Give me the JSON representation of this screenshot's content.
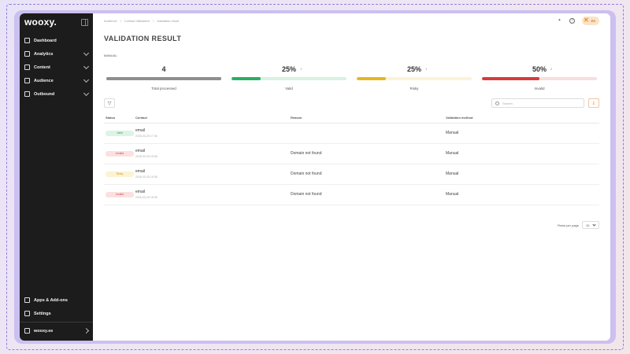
{
  "app": {
    "logo": "wooxy."
  },
  "sidebar": {
    "items": [
      {
        "label": "Dashboard",
        "has_children": false
      },
      {
        "label": "Analytics",
        "has_children": true
      },
      {
        "label": "Content",
        "has_children": true
      },
      {
        "label": "Audience",
        "has_children": true
      },
      {
        "label": "Outbound",
        "has_children": true
      }
    ],
    "bottom": [
      {
        "label": "Apps & Add-ons"
      },
      {
        "label": "Settings"
      }
    ],
    "workspace": "wooxy.ee"
  },
  "breadcrumb": [
    "Audience",
    "Contact Validation",
    "Validation result"
  ],
  "header": {
    "avatar_initials": "ES"
  },
  "page": {
    "title": "VALIDATION RESULT",
    "section": "MANUAL"
  },
  "stats": [
    {
      "value": "4",
      "sub": "",
      "label": "Total processed",
      "fill": 1.0,
      "color": "#8e8e8e",
      "track": "#8e8e8e"
    },
    {
      "value": "25%",
      "sub": "1",
      "label": "Valid",
      "fill": 0.25,
      "color": "#2aaf63",
      "track": "#d7f2e3"
    },
    {
      "value": "25%",
      "sub": "1",
      "label": "Risky",
      "fill": 0.25,
      "color": "#e6b820",
      "track": "#faf3d6"
    },
    {
      "value": "50%",
      "sub": "2",
      "label": "Invalid",
      "fill": 0.5,
      "color": "#d83a3a",
      "track": "#f9dede"
    }
  ],
  "toolbar": {
    "search_placeholder": "Search"
  },
  "table": {
    "columns": [
      "Status",
      "Contact",
      "Reason",
      "Validation method"
    ],
    "rows": [
      {
        "status": "Valid",
        "status_bg": "#dcf4e5",
        "status_color": "#3a9a5e",
        "contact": "email",
        "date": "2026-03-26 17:36",
        "reason": "",
        "method": "Manual"
      },
      {
        "status": "Invalid",
        "status_bg": "#fbe0e0",
        "status_color": "#cc4a4a",
        "contact": "email",
        "date": "2026-03-26 15:38",
        "reason": "Domain not found",
        "method": "Manual"
      },
      {
        "status": "Risky",
        "status_bg": "#fbf3d2",
        "status_color": "#c99a18",
        "contact": "email",
        "date": "2026-03-26 15:38",
        "reason": "Domain not found",
        "method": "Manual"
      },
      {
        "status": "Invalid",
        "status_bg": "#fbe0e0",
        "status_color": "#cc4a4a",
        "contact": "email",
        "date": "2026-03-26 18:36",
        "reason": "Domain not found",
        "method": "Manual"
      }
    ]
  },
  "pagination": {
    "rows_per_page_label": "Rows per page",
    "rows_per_page": "10"
  }
}
